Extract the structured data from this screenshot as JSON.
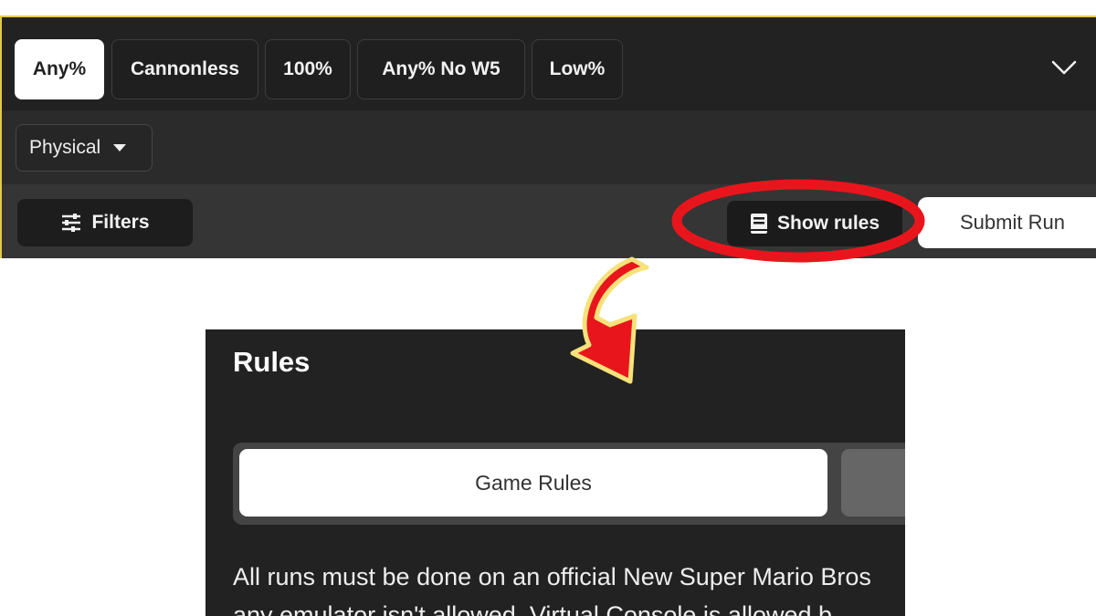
{
  "category_tabs": [
    {
      "label": "Any%",
      "active": true
    },
    {
      "label": "Cannonless",
      "active": false
    },
    {
      "label": "100%",
      "active": false
    },
    {
      "label": "Any% No W5",
      "active": false
    },
    {
      "label": "Low%",
      "active": false
    }
  ],
  "expand_icon": "chevron-down-icon",
  "platform_filter": {
    "value": "Physical"
  },
  "actions": {
    "filters_label": "Filters",
    "show_rules_label": "Show rules",
    "submit_run_label": "Submit Run"
  },
  "rules_panel": {
    "title": "Rules",
    "tabs": [
      {
        "label": "Game Rules",
        "active": true
      },
      {
        "label": "",
        "active": false
      }
    ],
    "body_lines": [
      "All runs must be done on an official New Super Mario Bros",
      "any emulator isn't allowed. Virtual Console is allowed b"
    ]
  },
  "colors": {
    "annotation_circle": "#e8161c",
    "arrow_fill": "#e8161c",
    "arrow_outline": "#f6e27a",
    "frame_border": "#e6c84a"
  }
}
